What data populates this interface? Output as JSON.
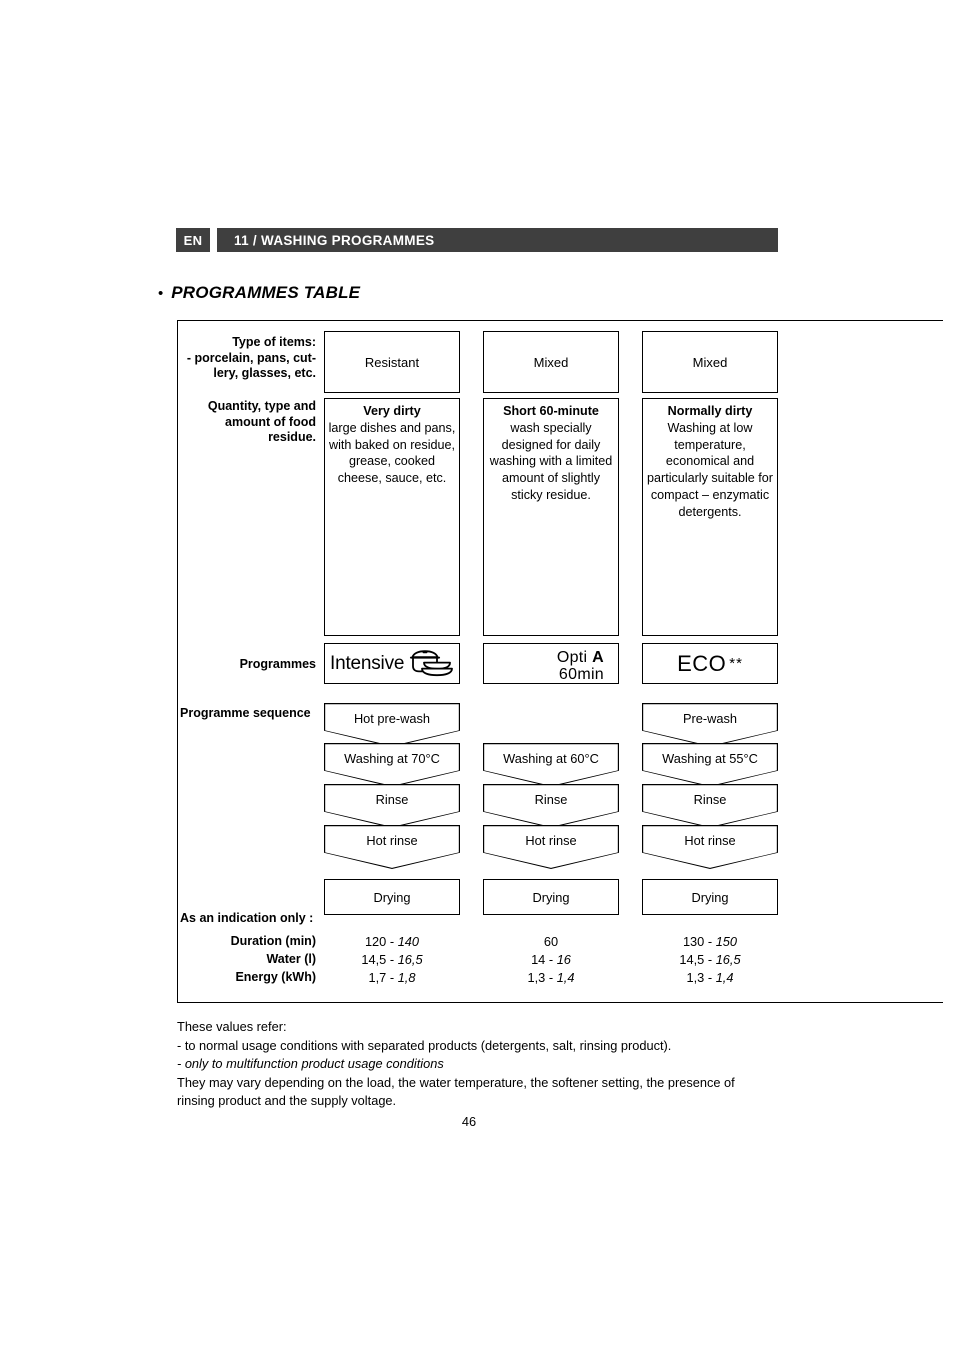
{
  "header": {
    "language_badge": "EN",
    "chapter": "11 / WASHING PROGRAMMES"
  },
  "section": {
    "bullet": "•",
    "title": "PROGRAMMES TABLE"
  },
  "row_labels": {
    "type_of_items": "Type of items:\n- porcelain, pans, cut-\nlery, glasses, etc.",
    "quantity": "Quantity, type and\namount of food\nresidue.",
    "programmes": "Programmes",
    "programme_sequence": "Programme sequence",
    "indication": "As an indication only :",
    "duration": "Duration (min)",
    "water": "Water (l)",
    "energy": "Energy (kWh)"
  },
  "columns": [
    {
      "type_of_items": "Resistant",
      "dirt_title": "Very dirty",
      "dirt_body": "large dishes and pans, with baked on residue, grease, cooked cheese, sauce, etc.",
      "programme_logo": {
        "kind": "intensive",
        "text": "Intensive",
        "icon": "pot-and-plates-icon"
      },
      "sequence": [
        "Hot pre-wash",
        "Washing at 70°C",
        "Rinse",
        "Hot rinse"
      ],
      "drying": "Drying",
      "duration": {
        "normal": "120",
        "separator": "-",
        "multi": "140"
      },
      "water": {
        "normal": "14,5",
        "separator": "-",
        "multi": "16,5"
      },
      "energy": {
        "normal": "1,7",
        "separator": "-",
        "multi": "1,8"
      }
    },
    {
      "type_of_items": "Mixed",
      "dirt_title": "Short 60-minute",
      "dirt_body": "wash specially designed for daily washing with a limited amount of slightly sticky residue.",
      "programme_logo": {
        "kind": "opti",
        "line1_prefix": "Opti ",
        "line1_letter": "A",
        "line2": "60min"
      },
      "sequence": [
        "",
        "Washing at 60°C",
        "Rinse",
        "Hot rinse"
      ],
      "drying": "Drying",
      "duration": {
        "normal": "60",
        "separator": "",
        "multi": ""
      },
      "water": {
        "normal": "14",
        "separator": "-",
        "multi": "16"
      },
      "energy": {
        "normal": "1,3",
        "separator": "-",
        "multi": "1,4"
      }
    },
    {
      "type_of_items": "Mixed",
      "dirt_title": "Normally dirty",
      "dirt_body": "Washing at low temperature, economical and particularly suitable for compact – enzymatic detergents.",
      "programme_logo": {
        "kind": "eco",
        "text": "ECO",
        "stars": "**"
      },
      "sequence": [
        "Pre-wash",
        "Washing at 55°C",
        "Rinse",
        "Hot rinse"
      ],
      "drying": "Drying",
      "duration": {
        "normal": "130",
        "separator": "-",
        "multi": "150"
      },
      "water": {
        "normal": "14,5",
        "separator": "-",
        "multi": "16,5"
      },
      "energy": {
        "normal": "1,3",
        "separator": "-",
        "multi": "1,4"
      }
    }
  ],
  "notes": {
    "line1": "These values refer:",
    "line2": "- to normal usage conditions with separated products (detergents, salt, rinsing product).",
    "line3_italic": "- only to multifunction product usage conditions",
    "line4": "They may vary depending on the load, the water temperature, the softener setting, the presence of",
    "line5": "rinsing product and the supply voltage."
  },
  "page_number": "46",
  "colors": {
    "header_bar": "#3f3f3f",
    "text": "#000000",
    "background": "#ffffff"
  }
}
